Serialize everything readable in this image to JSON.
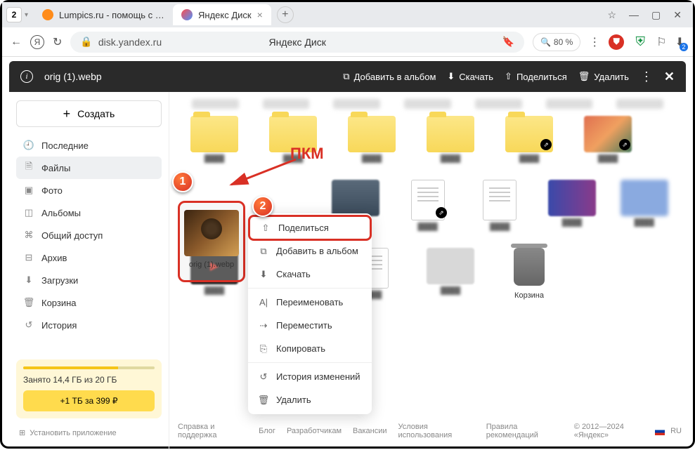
{
  "browser": {
    "tab_count": "2",
    "tabs": [
      {
        "label": "Lumpics.ru - помощь с ком",
        "active": false
      },
      {
        "label": "Яндекс Диск",
        "active": true
      }
    ],
    "url_host": "disk.yandex.ru",
    "page_title": "Яндекс Диск",
    "zoom": "80 %"
  },
  "actionbar": {
    "filename": "orig (1).webp",
    "add_album": "Добавить в альбом",
    "download": "Скачать",
    "share": "Поделиться",
    "delete": "Удалить"
  },
  "sidebar": {
    "create": "Создать",
    "items": [
      {
        "icon": "clock",
        "label": "Последние"
      },
      {
        "icon": "file",
        "label": "Файлы"
      },
      {
        "icon": "photo",
        "label": "Фото"
      },
      {
        "icon": "album",
        "label": "Альбомы"
      },
      {
        "icon": "shared",
        "label": "Общий доступ"
      },
      {
        "icon": "archive",
        "label": "Архив"
      },
      {
        "icon": "download",
        "label": "Загрузки"
      },
      {
        "icon": "trash",
        "label": "Корзина"
      },
      {
        "icon": "history",
        "label": "История"
      }
    ],
    "storage_text": "Занято 14,4 ГБ из 20 ГБ",
    "upgrade": "+1 ТБ за 399 ₽",
    "install": "Установить приложение"
  },
  "selected_file": "orig (1).webp",
  "context_menu": {
    "share": "Поделиться",
    "add_album": "Добавить в альбом",
    "download": "Скачать",
    "rename": "Переименовать",
    "move": "Переместить",
    "copy": "Копировать",
    "history": "История изменений",
    "delete": "Удалить"
  },
  "annotations": {
    "pkm": "ПКМ",
    "m1": "1",
    "m2": "2"
  },
  "grid": {
    "trash": "Корзина"
  },
  "footer": {
    "support": "Справка и поддержка",
    "blog": "Блог",
    "dev": "Разработчикам",
    "jobs": "Вакансии",
    "terms": "Условия использования",
    "rules": "Правила рекомендаций",
    "copyright": "© 2012—2024 «Яндекс»",
    "lang": "RU"
  }
}
